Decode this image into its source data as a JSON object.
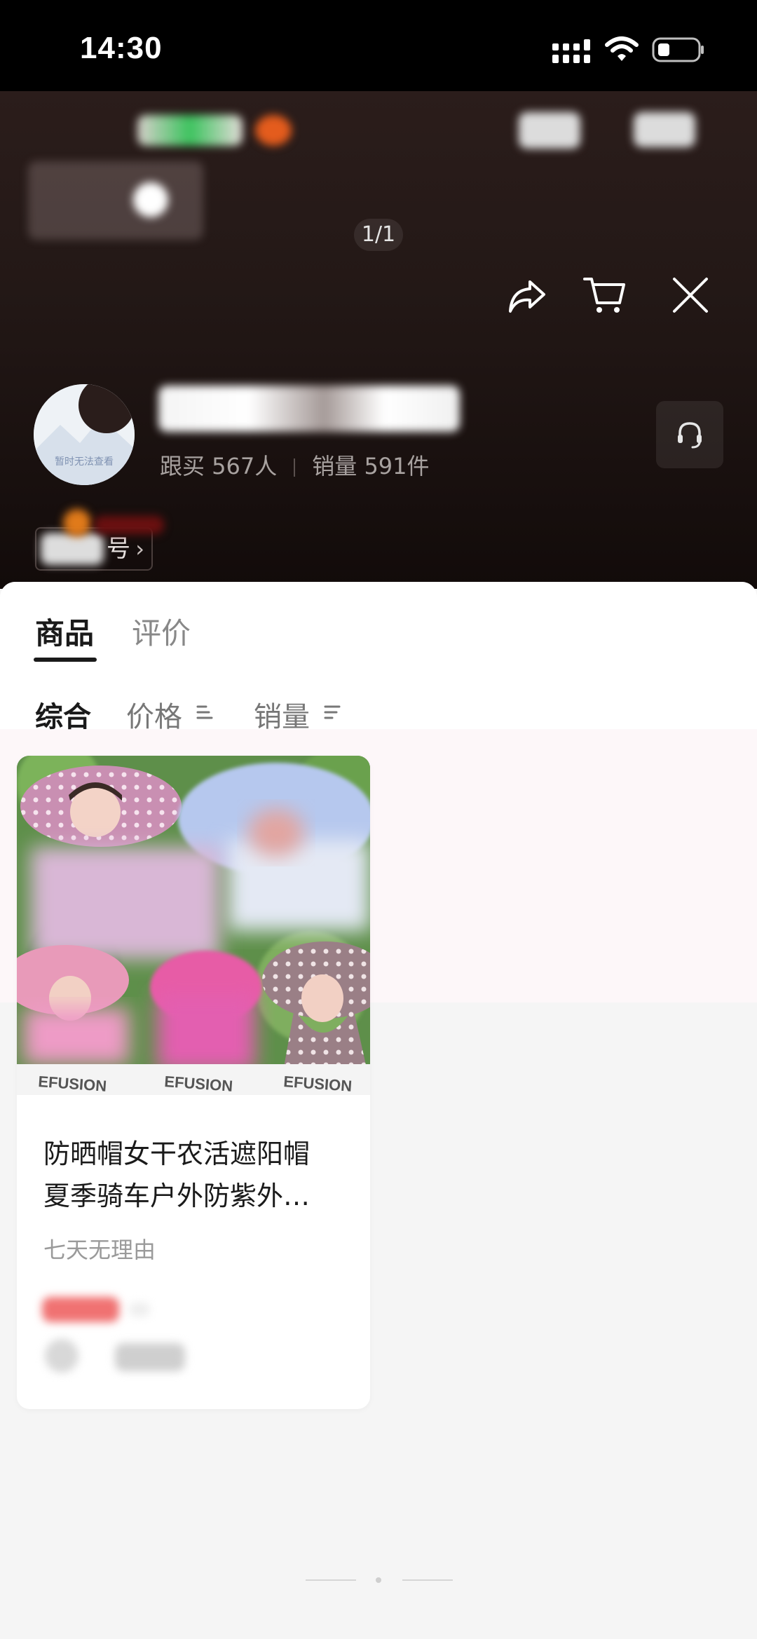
{
  "status_bar": {
    "time": "14:30"
  },
  "header": {
    "page_indicator": "1/1",
    "avatar_placeholder_text": "暂时无法查看",
    "shop_stats": {
      "followers": "跟买 567人",
      "sales": "销量 591件"
    },
    "follow_tag_label": "号"
  },
  "tabs": {
    "products": "商品",
    "reviews": "评价"
  },
  "sort": {
    "general": "综合",
    "price": "价格",
    "sales": "销量"
  },
  "products": [
    {
      "title_line1": "防晒帽女干农活遮阳帽",
      "title_line2": "夏季骑车户外防紫外…",
      "tag": "七天无理由"
    }
  ],
  "colors": {
    "header_bg": "#231816",
    "sheet_bg": "#f5f5f5",
    "text_primary": "#1a1a1a",
    "text_secondary": "#888888"
  }
}
